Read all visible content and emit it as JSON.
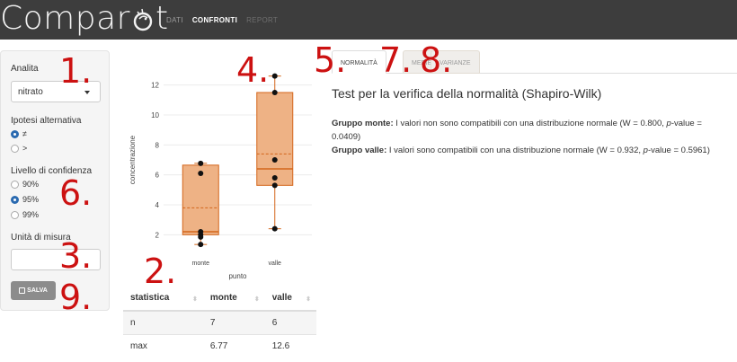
{
  "navbar": {
    "brand_prefix": "Compar",
    "brand_suffix": "t",
    "links": [
      {
        "label": "DATI",
        "state": "inactive"
      },
      {
        "label": "CONFRONTI",
        "state": "active"
      },
      {
        "label": "REPORT",
        "state": "disabled"
      }
    ]
  },
  "sidebar": {
    "analita_label": "Analita",
    "analita_value": "nitrato",
    "ipotesi_label": "Ipotesi alternativa",
    "ipotesi_options": [
      {
        "label": "≠",
        "checked": true
      },
      {
        "label": ">",
        "checked": false
      }
    ],
    "confidenza_label": "Livello di confidenza",
    "confidenza_options": [
      {
        "label": "90%",
        "checked": false
      },
      {
        "label": "95%",
        "checked": true
      },
      {
        "label": "99%",
        "checked": false
      }
    ],
    "unita_label": "Unità di misura",
    "unita_value": "",
    "save_label": "SALVA"
  },
  "annotations": {
    "n1": "1.",
    "n2": "2.",
    "n3": "3.",
    "n4": "4.",
    "n5": "5.",
    "n6": "6.",
    "n7": "7.",
    "n8": "8.",
    "n9": "9."
  },
  "chart_data": {
    "type": "box",
    "xlabel": "punto",
    "ylabel": "concentrazione",
    "ylim": [
      1,
      13
    ],
    "yticks": [
      2,
      4,
      6,
      8,
      10,
      12
    ],
    "categories": [
      "monte",
      "valle"
    ],
    "color": "#d4661b",
    "boxes": [
      {
        "name": "monte",
        "min": 1.35,
        "q1": 2.0,
        "median": 2.2,
        "mean": 3.8,
        "q3": 6.65,
        "max": 6.77,
        "points": [
          6.77,
          6.1,
          2.2,
          2.0,
          1.85,
          1.35
        ]
      },
      {
        "name": "valle",
        "min": 2.4,
        "q1": 5.3,
        "median": 6.4,
        "mean": 7.4,
        "q3": 11.5,
        "max": 12.6,
        "points": [
          12.6,
          11.5,
          7.0,
          5.8,
          5.3,
          2.4
        ]
      }
    ]
  },
  "table": {
    "headers": [
      "statistica",
      "monte",
      "valle"
    ],
    "rows": [
      [
        "n",
        "7",
        "6"
      ],
      [
        "max",
        "6.77",
        "12.6"
      ]
    ]
  },
  "tabs": [
    {
      "label": "NORMALITÀ",
      "state": "active"
    },
    {
      "label": "MEDIE",
      "state": "inactive"
    },
    {
      "label": "VARIANZE",
      "state": "inactive"
    }
  ],
  "content": {
    "title": "Test per la verifica della normalità (Shapiro-Wilk)",
    "group1_label": "Gruppo monte:",
    "group1_text_a": " I valori non sono compatibili con una distribuzione normale (W = 0.800, ",
    "group1_p": "p",
    "group1_text_b": "-value = 0.0409)",
    "group2_label": "Gruppo valle:",
    "group2_text_a": " I valori sono compatibili con una distribuzione normale (W = 0.932, ",
    "group2_p": "p",
    "group2_text_b": "-value = 0.5961)"
  }
}
